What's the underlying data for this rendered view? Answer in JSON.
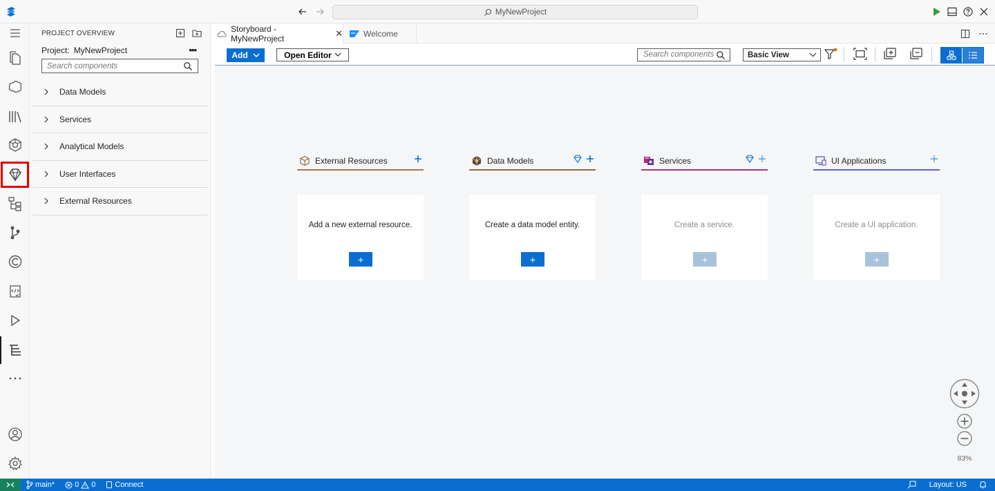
{
  "titlebar": {
    "search_text": "MyNewProject"
  },
  "activity_bar": {
    "items": [
      "explorer",
      "cloud-foundry",
      "library",
      "extensions",
      "storyboard",
      "hierarchy",
      "source-control",
      "copyright",
      "code-check",
      "run",
      "outline",
      "more"
    ],
    "highlighted": "storyboard",
    "active": "outline",
    "bottom": [
      "account",
      "settings"
    ]
  },
  "sidebar": {
    "title": "PROJECT OVERVIEW",
    "project_label": "Project:",
    "project_name": "MyNewProject",
    "more": "•••",
    "search_placeholder": "Search components",
    "items": [
      {
        "label": "Data Models"
      },
      {
        "label": "Services"
      },
      {
        "label": "Analytical Models"
      },
      {
        "label": "User Interfaces"
      },
      {
        "label": "External Resources"
      }
    ]
  },
  "tabs": [
    {
      "label": "Storyboard - MyNewProject",
      "close": "✕",
      "active": true
    },
    {
      "label": "Welcome",
      "active": false
    }
  ],
  "toolbar": {
    "add_label": "Add",
    "open_editor_label": "Open Editor",
    "search_placeholder": "Search components",
    "view_value": "Basic View"
  },
  "columns": [
    {
      "title": "External Resources",
      "card_text": "Add a new external resource.",
      "color": "#a07a4f",
      "enabled": true,
      "add": "+"
    },
    {
      "title": "Data Models",
      "card_text": "Create a data model entity.",
      "color": "#8d6a44",
      "enabled": true,
      "add": "+"
    },
    {
      "title": "Services",
      "card_text": "Create a service.",
      "color": "#b0307e",
      "enabled": false,
      "add": "+"
    },
    {
      "title": "UI Applications",
      "card_text": "Create a UI application.",
      "color": "#5a5fd6",
      "enabled": false,
      "add": "+"
    }
  ],
  "canvas": {
    "zoom": "83%"
  },
  "statusbar": {
    "branch": "main*",
    "errors": "0",
    "warnings": "0",
    "connect": "Connect",
    "layout": "Layout: US"
  },
  "colors": {
    "accent": "#0a6ed1",
    "remote": "#16825d",
    "highlight": "#e00000"
  }
}
